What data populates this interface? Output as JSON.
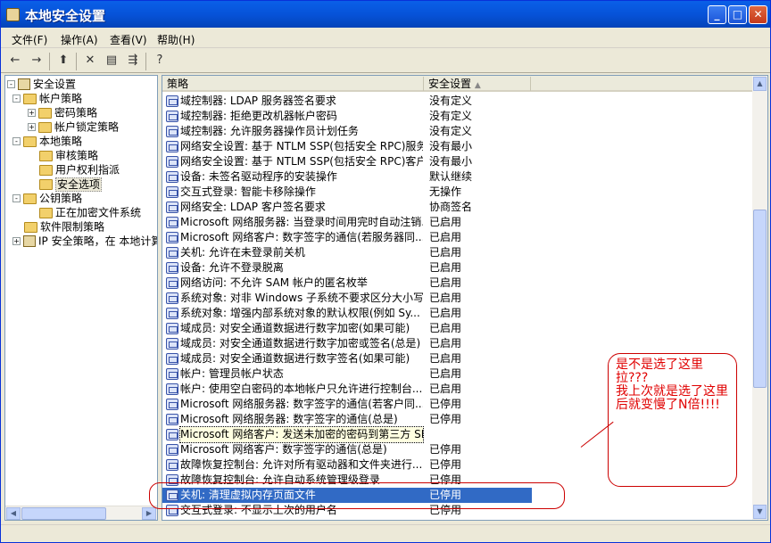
{
  "window": {
    "title": "本地安全设置"
  },
  "menu": [
    "文件(F)",
    "操作(A)",
    "查看(V)",
    "帮助(H)"
  ],
  "tree": [
    {
      "label": "安全设置",
      "level": 0,
      "expander": "-",
      "icon": "security-icon"
    },
    {
      "label": "帐户策略",
      "level": 1,
      "expander": "-",
      "icon": "folder-icon"
    },
    {
      "label": "密码策略",
      "level": 2,
      "expander": "+",
      "icon": "folder-icon"
    },
    {
      "label": "帐户锁定策略",
      "level": 2,
      "expander": "+",
      "icon": "folder-icon"
    },
    {
      "label": "本地策略",
      "level": 1,
      "expander": "-",
      "icon": "folder-icon"
    },
    {
      "label": "审核策略",
      "level": 2,
      "expander": "",
      "icon": "folder-icon"
    },
    {
      "label": "用户权利指派",
      "level": 2,
      "expander": "",
      "icon": "folder-icon"
    },
    {
      "label": "安全选项",
      "level": 2,
      "expander": "",
      "icon": "folder-icon",
      "selected": true
    },
    {
      "label": "公钥策略",
      "level": 1,
      "expander": "-",
      "icon": "folder-icon"
    },
    {
      "label": "正在加密文件系统",
      "level": 2,
      "expander": "",
      "icon": "folder-icon"
    },
    {
      "label": "软件限制策略",
      "level": 1,
      "expander": "",
      "icon": "folder-icon"
    },
    {
      "label": "IP 安全策略，在 本地计算机",
      "level": 1,
      "expander": "+",
      "icon": "ip-security-icon"
    }
  ],
  "list": {
    "columns": [
      "策略",
      "安全设置"
    ],
    "rows": [
      {
        "name": "域控制器: LDAP 服务器签名要求",
        "value": "没有定义"
      },
      {
        "name": "域控制器: 拒绝更改机器帐户密码",
        "value": "没有定义"
      },
      {
        "name": "域控制器: 允许服务器操作员计划任务",
        "value": "没有定义"
      },
      {
        "name": "网络安全设置: 基于 NTLM SSP(包括安全 RPC)服务...",
        "value": "没有最小"
      },
      {
        "name": "网络安全设置: 基于 NTLM SSP(包括安全 RPC)客户...",
        "value": "没有最小"
      },
      {
        "name": "设备: 未签名驱动程序的安装操作",
        "value": "默认继续"
      },
      {
        "name": "交互式登录: 智能卡移除操作",
        "value": "无操作"
      },
      {
        "name": "网络安全: LDAP 客户签名要求",
        "value": "协商签名"
      },
      {
        "name": "Microsoft 网络服务器: 当登录时间用完时自动注销...",
        "value": "已启用"
      },
      {
        "name": "Microsoft 网络客户: 数字签字的通信(若服务器同...",
        "value": "已启用"
      },
      {
        "name": "关机: 允许在未登录前关机",
        "value": "已启用"
      },
      {
        "name": "设备: 允许不登录脱离",
        "value": "已启用"
      },
      {
        "name": "网络访问: 不允许 SAM 帐户的匿名枚举",
        "value": "已启用"
      },
      {
        "name": "系统对象: 对非 Windows 子系统不要求区分大小写",
        "value": "已启用"
      },
      {
        "name": "系统对象: 增强内部系统对象的默认权限(例如 Sy...",
        "value": "已启用"
      },
      {
        "name": "域成员: 对安全通道数据进行数字加密(如果可能)",
        "value": "已启用"
      },
      {
        "name": "域成员: 对安全通道数据进行数字加密或签名(总是)",
        "value": "已启用"
      },
      {
        "name": "域成员: 对安全通道数据进行数字签名(如果可能)",
        "value": "已启用"
      },
      {
        "name": "帐户: 管理员帐户状态",
        "value": "已启用"
      },
      {
        "name": "帐户: 使用空白密码的本地帐户只允许进行控制台...",
        "value": "已启用"
      },
      {
        "name": "Microsoft 网络服务器: 数字签字的通信(若客户同...",
        "value": "已停用"
      },
      {
        "name": "Microsoft 网络服务器: 数字签字的通信(总是)",
        "value": "已停用"
      },
      {
        "name": "Microsoft 网络客户: 发送未加密的密码到第三方 SMB 服务器。",
        "value": "",
        "focus": true
      },
      {
        "name": "Microsoft 网络客户: 数字签字的通信(总是)",
        "value": "已停用"
      },
      {
        "name": "故障恢复控制台: 允许对所有驱动器和文件夹进行...",
        "value": "已停用"
      },
      {
        "name": "故障恢复控制台: 允许自动系统管理级登录",
        "value": "已停用"
      },
      {
        "name": "关机: 清理虚拟内存页面文件",
        "value": "已停用",
        "selected": true
      },
      {
        "name": "交互式登录: 不显示上次的用户名",
        "value": "已停用"
      }
    ]
  },
  "annotation": {
    "text": "是不是选了这里拉???\n我上次就是选了这里后就变慢了N倍!!!!"
  },
  "colors": {
    "accent": "#316AC5",
    "annotation": "#E00000"
  }
}
